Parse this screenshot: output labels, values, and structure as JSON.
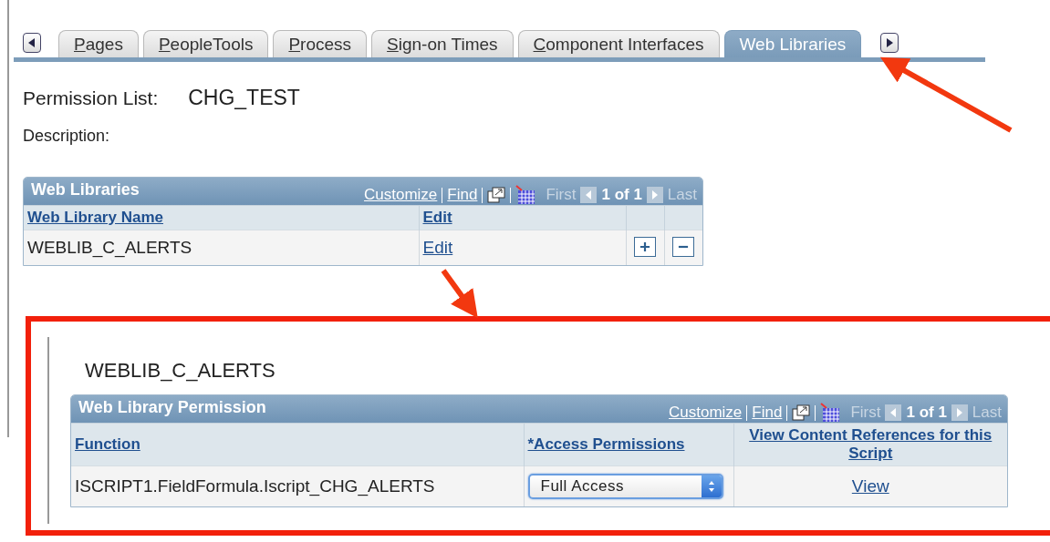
{
  "tabs": [
    {
      "label": "Pages",
      "selected": false
    },
    {
      "label": "PeopleTools",
      "selected": false
    },
    {
      "label": "Process",
      "selected": false
    },
    {
      "label": "Sign-on Times",
      "selected": false
    },
    {
      "label": "Component Interfaces",
      "selected": false
    },
    {
      "label": "Web Libraries",
      "selected": true
    }
  ],
  "permission_list": {
    "label": "Permission List:",
    "value": "CHG_TEST"
  },
  "description": {
    "label": "Description:"
  },
  "web_libraries_grid": {
    "title": "Web Libraries",
    "customize": "Customize",
    "find": "Find",
    "first": "First",
    "count": "1 of 1",
    "last": "Last",
    "columns": [
      "Web Library Name",
      "Edit"
    ],
    "rows": [
      {
        "cells": [
          "WEBLIB_C_ALERTS",
          "Edit"
        ]
      }
    ]
  },
  "detail": {
    "title": "WEBLIB_C_ALERTS",
    "grid": {
      "title": "Web Library Permission",
      "customize": "Customize",
      "find": "Find",
      "first": "First",
      "count": "1 of 1",
      "last": "Last",
      "columns": [
        "Function",
        "*Access Permissions",
        "View Content References for this Script"
      ],
      "rows": [
        {
          "cells": [
            "ISCRIPT1.FieldFormula.Iscript_CHG_ALERTS",
            "Full Access",
            "View"
          ]
        }
      ]
    }
  }
}
